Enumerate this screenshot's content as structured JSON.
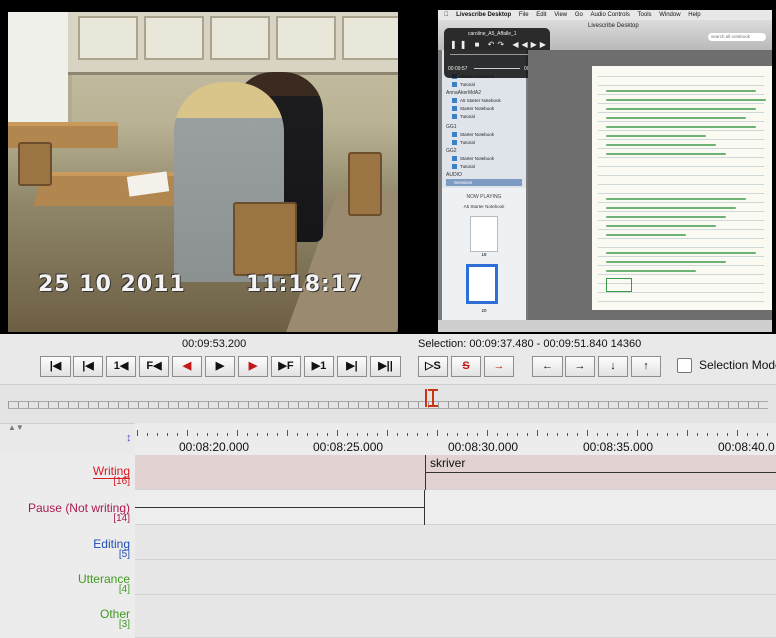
{
  "video": {
    "date_stamp": "25 10 2011",
    "time_stamp": "11:18:17"
  },
  "screen_capture": {
    "app_menu": [
      "Livescribe Desktop",
      "File",
      "Edit",
      "View",
      "Go",
      "Audio Controls",
      "Tools",
      "Window",
      "Help"
    ],
    "window_title": "Livescribe Desktop",
    "search_placeholder": "search all notebook",
    "hud_title": "caroline_A5_Affalle_1",
    "hud_time_left": "00:09:57",
    "hud_time_right": "00:09:02",
    "sidebar_items": [
      "Starter Notebook",
      "Tutorial",
      "AnnaAkerMdA2",
      "A5 Starter Notebook",
      "Starter Notebook",
      "Tutorial",
      "GG1",
      "Starter Notebook",
      "Tutorial",
      "GG2",
      "Starter Notebook",
      "Tutorial",
      "AUDIO",
      "Sessions"
    ],
    "now_playing_title": "NOW PLAYING",
    "now_playing_notebook": "A5 Starter Notebook",
    "page_numbers": [
      "18",
      "20"
    ]
  },
  "controls": {
    "current_time": "00:09:53.200",
    "selection": "Selection: 00:09:37.480 - 00:09:51.840  14360",
    "selection_mode_label": "Selection Mode",
    "buttons": {
      "go_to_begin": "|◀",
      "prev_frame": "|◀",
      "back_1s": "1◀",
      "frame_f": "F◀",
      "prev_annot": "◀",
      "play": "▶",
      "play_sel": "▶",
      "next_f": "▶F",
      "forward_1s": "▶1",
      "next_frame": "▶|",
      "go_to_end": "▶||",
      "sel_s": "▷S",
      "clear_sel": "S",
      "to_sel": "→",
      "left": "←",
      "right": "→",
      "down": "↓",
      "up": "↑"
    }
  },
  "timeline": {
    "ruler_labels": [
      "00:08:20.000",
      "00:08:25.000",
      "00:08:30.000",
      "00:08:35.000",
      "00:08:40.0"
    ],
    "tiers": [
      {
        "name": "Writing",
        "count": "[16]",
        "color": "#d61b24"
      },
      {
        "name": "Pause (Not writing)",
        "count": "[14]",
        "color": "#a81a52"
      },
      {
        "name": "Editing",
        "count": "[5]",
        "color": "#1f4fb0"
      },
      {
        "name": "Utterance",
        "count": "[4]",
        "color": "#3f9a1e"
      },
      {
        "name": "Other",
        "count": "[3]",
        "color": "#3f9a1e"
      }
    ],
    "annotation_writing": "skriver"
  }
}
